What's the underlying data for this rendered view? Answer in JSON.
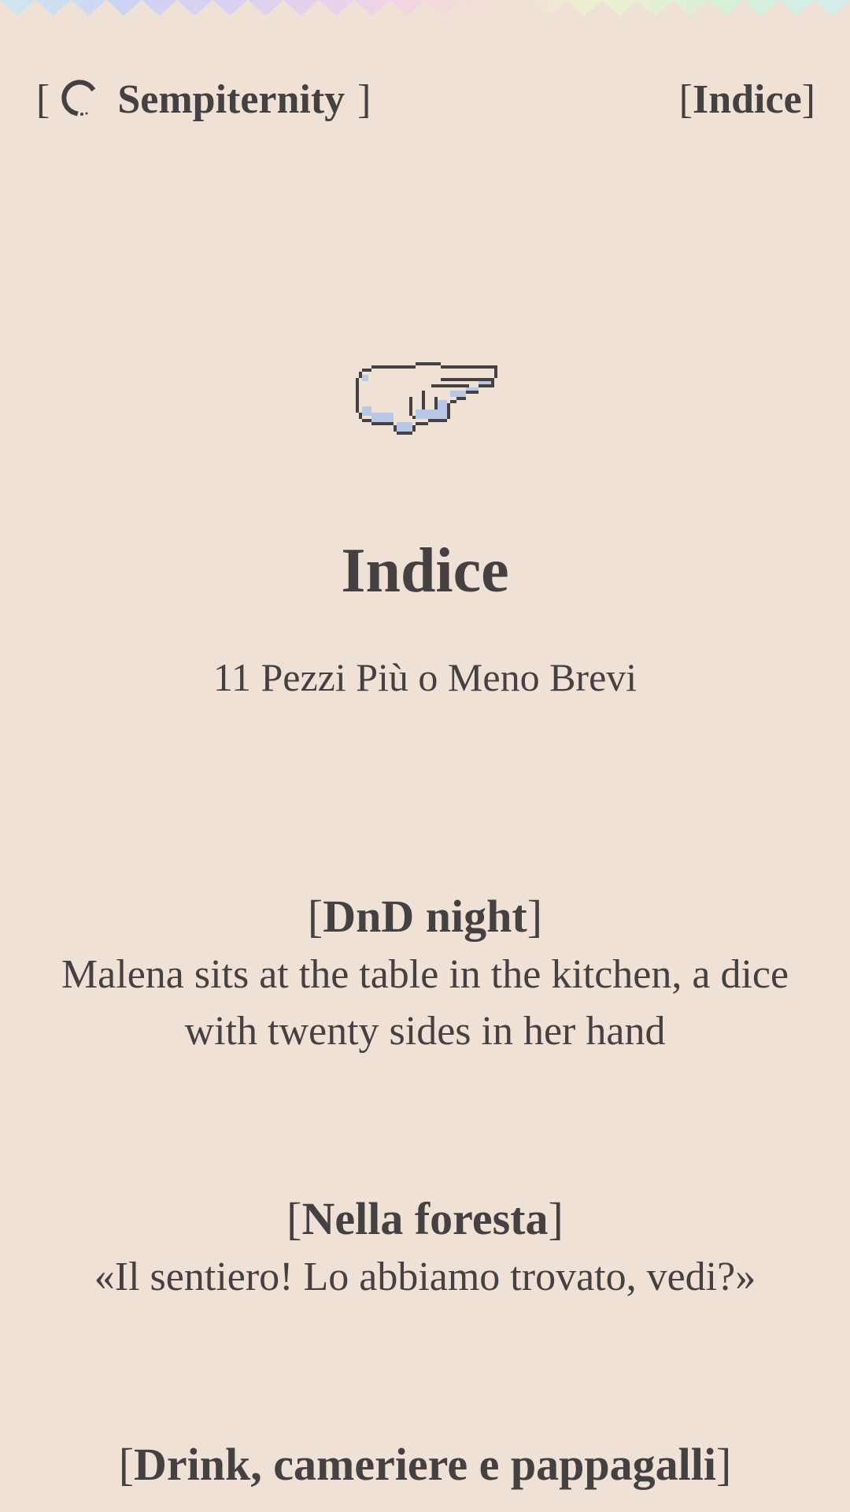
{
  "header": {
    "bracket_open": "[",
    "bracket_close": "]",
    "site_name": "Sempiternity",
    "spinner_icon": "loading-spinner-icon",
    "index_link": "Indice"
  },
  "hero": {
    "icon": "pixel-pointing-hand-icon",
    "title": "Indice",
    "subtitle": "11 Pezzi Più o Meno Brevi"
  },
  "entries": [
    {
      "title": "DnD night",
      "excerpt": "Malena sits at the table in the kitchen, a dice with twenty sides in her hand"
    },
    {
      "title": "Nella foresta",
      "excerpt": "«Il sentiero! Lo abbiamo trovato, vedi?»"
    },
    {
      "title": "Drink, cameriere e pappagalli",
      "excerpt": ""
    }
  ],
  "colors": {
    "background": "#efe1d6",
    "text": "#454143",
    "hand_fill": "#b9c8e6"
  }
}
